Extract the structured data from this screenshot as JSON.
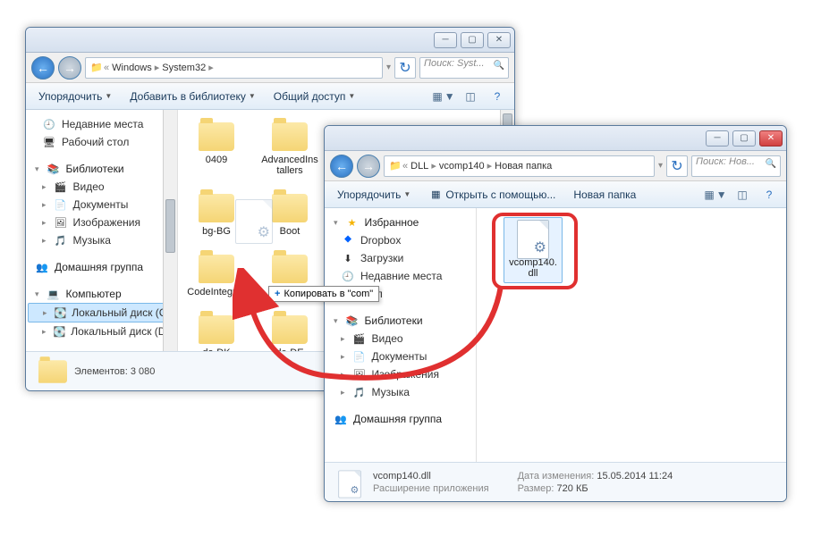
{
  "win1": {
    "breadcrumb": [
      "Windows",
      "System32"
    ],
    "search_placeholder": "Поиск: Syst...",
    "toolbar": {
      "organize": "Упорядочить",
      "add_lib": "Добавить в библиотеку",
      "share": "Общий доступ"
    },
    "sidebar": {
      "recent": "Недавние места",
      "desktop": "Рабочий стол",
      "libraries": "Библиотеки",
      "video": "Видео",
      "documents": "Документы",
      "images": "Изображения",
      "music": "Музыка",
      "homegroup": "Домашняя группа",
      "computer": "Компьютер",
      "disk_c": "Локальный диск (C:)",
      "disk_d": "Локальный диск (D:)"
    },
    "folders": [
      "0409",
      "AdvancedInstallers",
      "bg-BG",
      "Boot",
      "CodeIntegrity",
      "com",
      "da-DK",
      "de-DE"
    ],
    "status": "Элементов: 3 080"
  },
  "win2": {
    "breadcrumb": [
      "DLL",
      "vcomp140",
      "Новая папка"
    ],
    "search_placeholder": "Поиск: Нов...",
    "toolbar": {
      "organize": "Упорядочить",
      "open_with": "Открыть с помощью...",
      "new_folder": "Новая папка"
    },
    "sidebar": {
      "favorites": "Избранное",
      "dropbox": "Dropbox",
      "downloads": "Загрузки",
      "recent": "Недавние места",
      "desktop": "стол",
      "libraries": "Библиотеки",
      "video": "Видео",
      "documents": "Документы",
      "images": "Изображения",
      "music": "Музыка",
      "homegroup": "Домашняя группа"
    },
    "file": {
      "name": "vcomp140.dll",
      "short": "vcomp140.",
      "ext_line": "dll"
    },
    "status": {
      "name": "vcomp140.dll",
      "type": "Расширение приложения",
      "date_label": "Дата изменения:",
      "date": "15.05.2014 11:24",
      "size_label": "Размер:",
      "size": "720 КБ"
    }
  },
  "dragtip": "Копировать в \"com\""
}
